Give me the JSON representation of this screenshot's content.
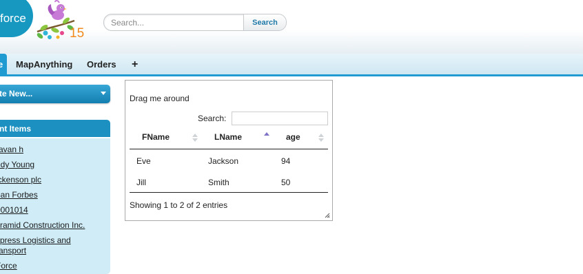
{
  "header": {
    "logo_text": "force",
    "logo_number": "15",
    "search_placeholder": "Search...",
    "search_button": "Search"
  },
  "tabs": [
    {
      "label": "e"
    },
    {
      "label": "MapAnything"
    },
    {
      "label": "Orders"
    },
    {
      "label": "+"
    }
  ],
  "sidebar": {
    "create_new": "te New...",
    "recent_title": "nt Items",
    "recent_items": [
      "ravan h",
      "ndy Young",
      "ickenson plc",
      "ean Forbes",
      "0001014",
      "yramid Construction Inc.",
      "xpress Logistics and",
      "ransport",
      "Force"
    ]
  },
  "widget": {
    "title": "Drag me around",
    "search_label": "Search:",
    "search_value": "",
    "columns": [
      "FName",
      "LName",
      "age"
    ],
    "sorted_column": "LName",
    "sort_direction": "ascending",
    "rows": [
      [
        "Eve",
        "Jackson",
        "94"
      ],
      [
        "Jill",
        "Smith",
        "50"
      ]
    ],
    "info": "Showing 1 to 2 of 2 entries"
  }
}
